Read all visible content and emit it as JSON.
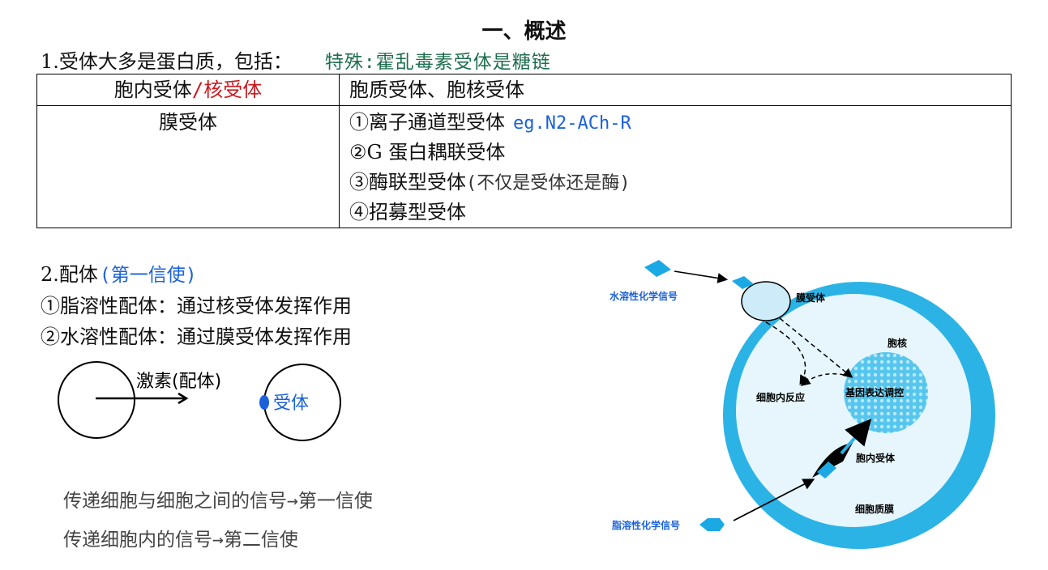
{
  "title": "一、概述",
  "section1": {
    "intro": "1.受体大多是蛋白质，包括：",
    "special_note": "特殊:霍乱毒素受体是糖链",
    "table": {
      "row1": {
        "left_a": "胞内受体",
        "left_b": "/核受体",
        "right": "胞质受体、胞核受体"
      },
      "row2": {
        "left": "膜受体",
        "items": [
          {
            "text": "①离子通道型受体",
            "note": "eg.N2-ACh-R"
          },
          {
            "text": "②G 蛋白耦联受体",
            "note": ""
          },
          {
            "text": "③酶联型受体",
            "note": "(不仅是受体还是酶)"
          },
          {
            "text": "④招募型受体",
            "note": ""
          }
        ]
      }
    }
  },
  "section2": {
    "heading": "2.配体",
    "heading_note": "(第一信使)",
    "line1": "①脂溶性配体：通过核受体发挥作用",
    "line2": "②水溶性配体：通过膜受体发挥作用"
  },
  "sketch": {
    "arrow_label": "激素(配体)",
    "receptor_label": "受体"
  },
  "notes": {
    "line1": "传递细胞与细胞之间的信号→第一信使",
    "line2": "传递细胞内的信号→第二信使"
  },
  "cell_diagram": {
    "water_signal": "水溶性化学信号",
    "membrane_receptor": "膜受体",
    "nucleus": "胞核",
    "cell_response": "细胞内反应",
    "gene_regulation": "基因表达调控",
    "intracellular_receptor": "胞内受体",
    "plasma_membrane": "细胞质膜",
    "lipid_signal": "脂溶性化学信号"
  },
  "colors": {
    "red": "#c8191e",
    "green": "#1e6e4e",
    "blue": "#1b62d9",
    "cyan": "#2bb3e6"
  }
}
